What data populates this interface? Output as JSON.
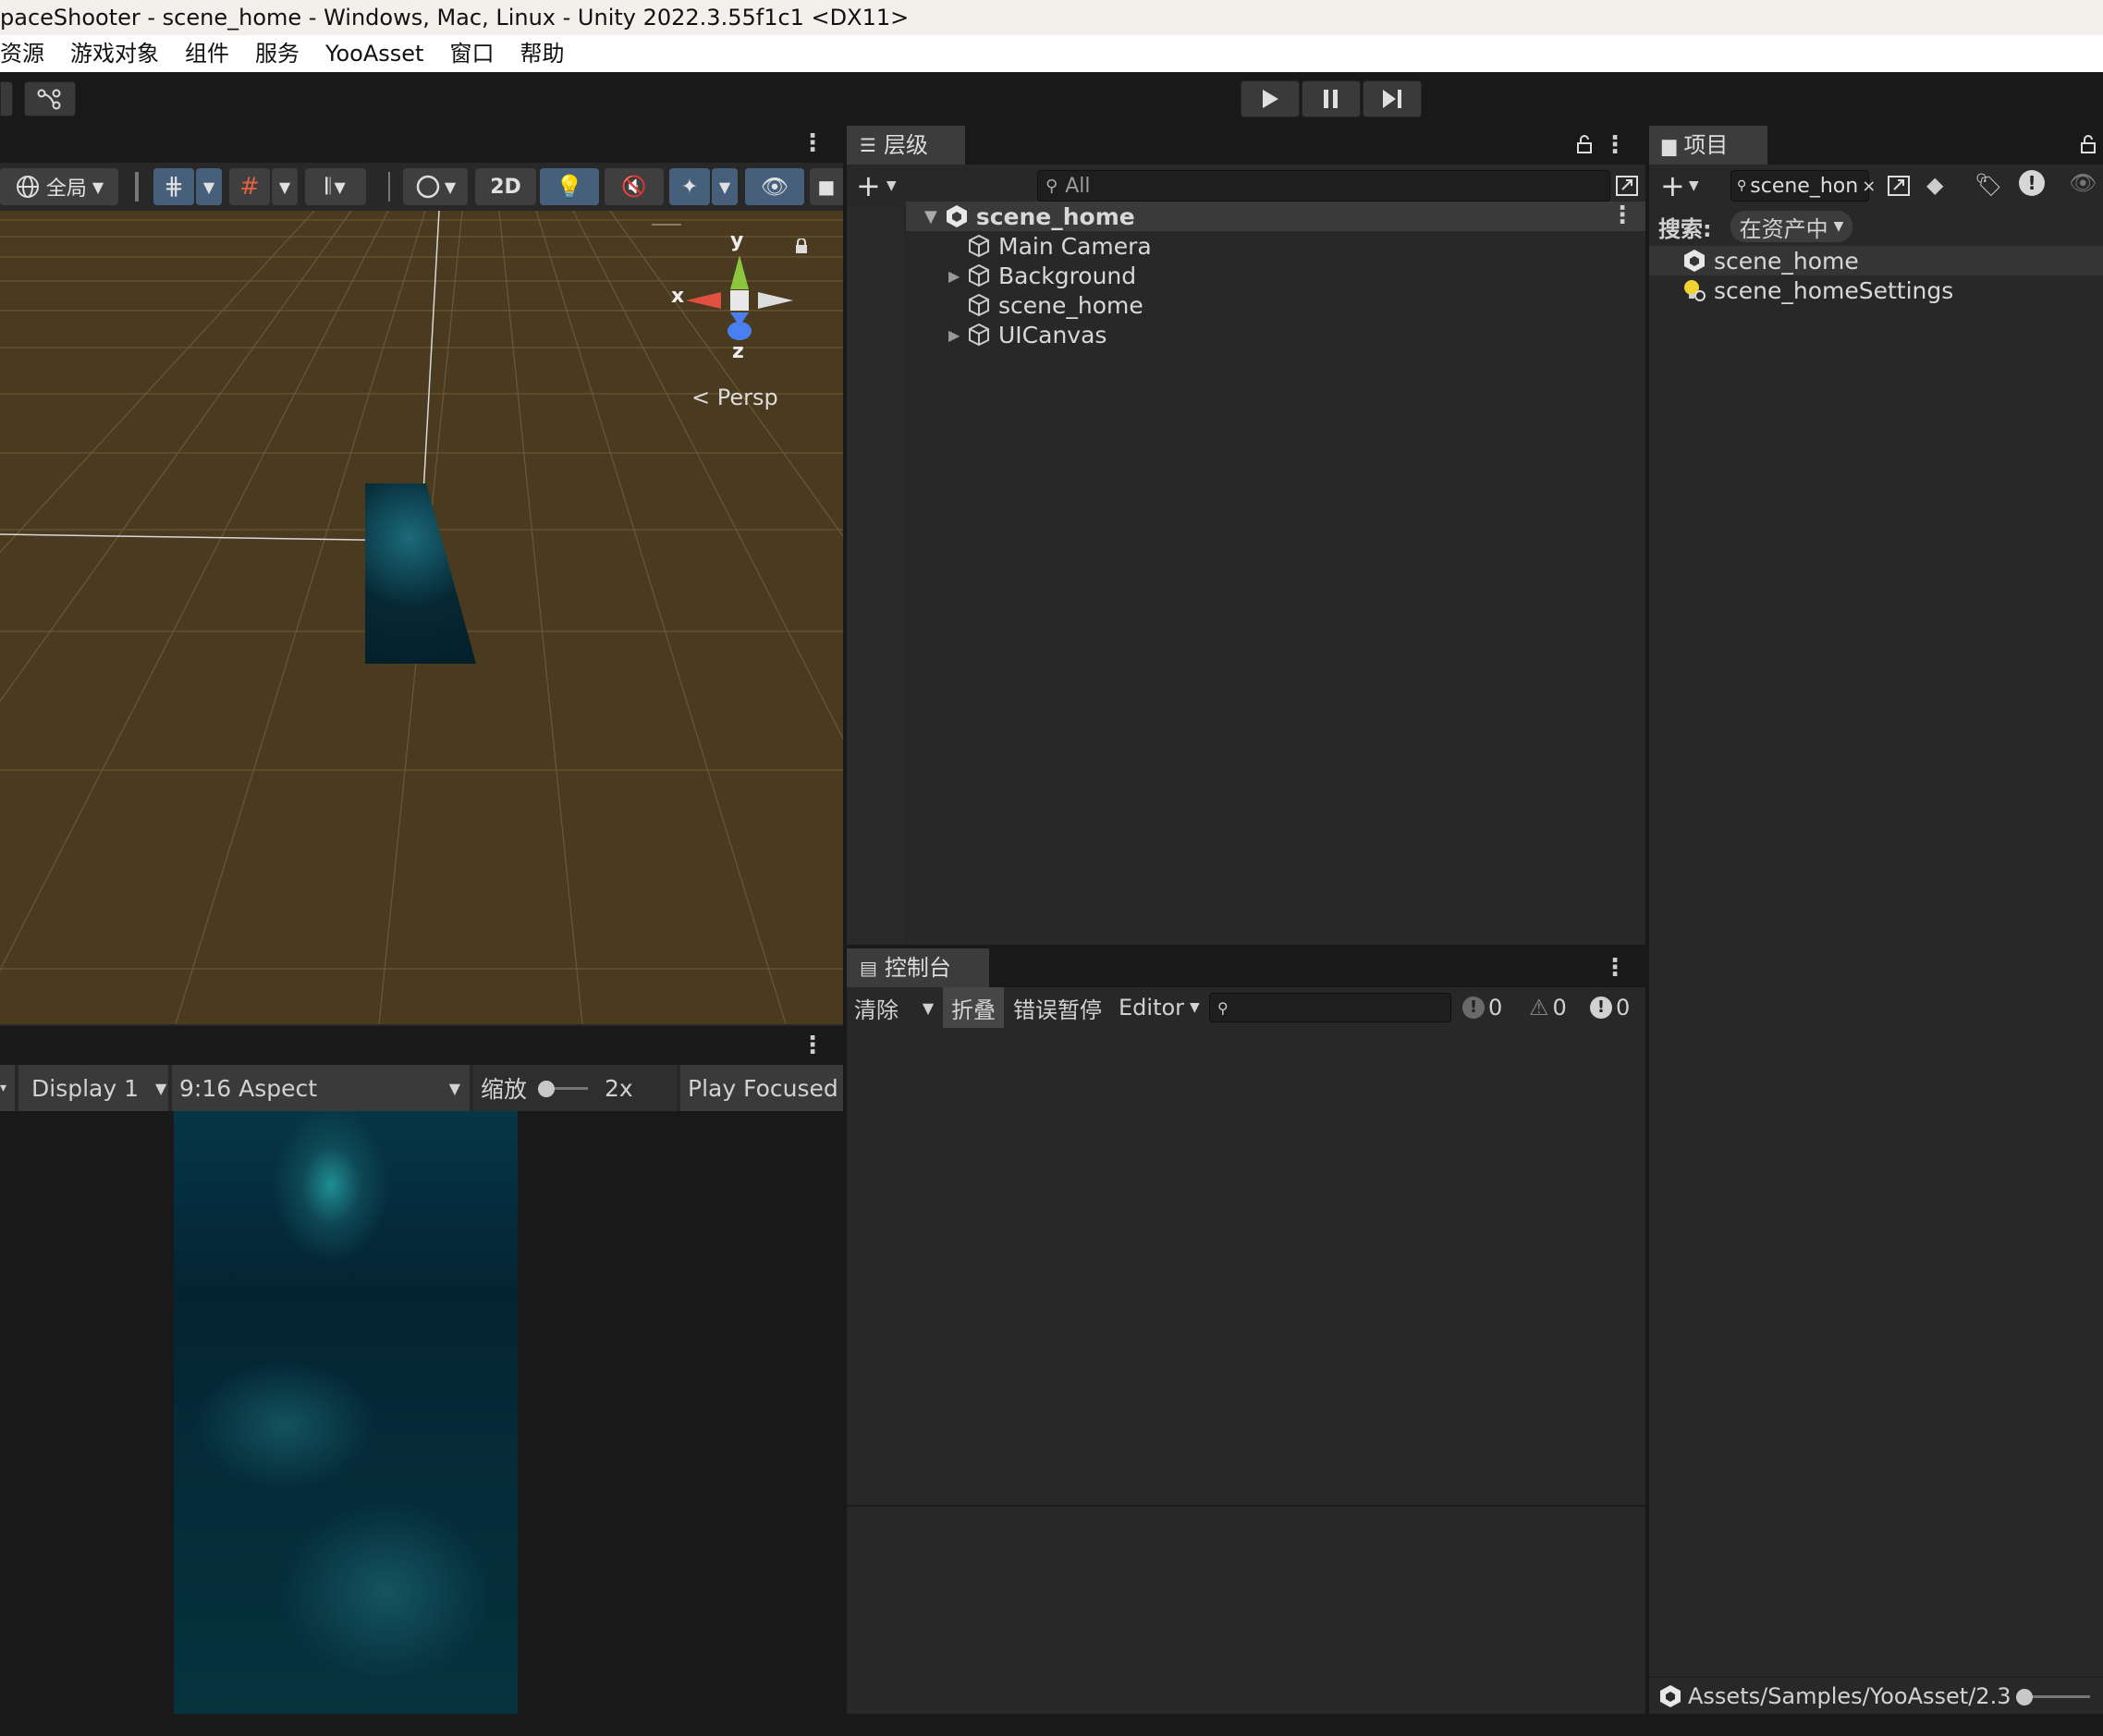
{
  "window": {
    "title": "paceShooter - scene_home - Windows, Mac, Linux - Unity 2022.3.55f1c1 <DX11>"
  },
  "menu": [
    "资源",
    "游戏对象",
    "组件",
    "服务",
    "YooAsset",
    "窗口",
    "帮助"
  ],
  "scene": {
    "toolbar": {
      "global_label": "全局",
      "two_d_label": "2D"
    },
    "gizmo": {
      "y": "y",
      "x": "x",
      "z": "z",
      "projection": "Persp"
    }
  },
  "game": {
    "display": "Display 1",
    "aspect": "9:16 Aspect",
    "scale_label": "缩放",
    "scale_value": "2x",
    "play_mode": "Play Focused"
  },
  "hierarchy": {
    "tab": "层级",
    "search_placeholder": "All",
    "root": "scene_home",
    "items": [
      {
        "label": "Main Camera",
        "expandable": false
      },
      {
        "label": "Background",
        "expandable": true
      },
      {
        "label": "scene_home",
        "expandable": false
      },
      {
        "label": "UICanvas",
        "expandable": true
      }
    ]
  },
  "console": {
    "tab": "控制台",
    "clear": "清除",
    "collapse": "折叠",
    "error_pause": "错误暂停",
    "editor": "Editor",
    "log_count": "0",
    "warn_count": "0",
    "error_count": "0"
  },
  "project": {
    "tab": "项目",
    "search_value": "scene_hon",
    "search_label": "搜索:",
    "search_scope": "在资产中",
    "items": [
      {
        "label": "scene_home",
        "icon": "unity-scene-icon"
      },
      {
        "label": "scene_homeSettings",
        "icon": "lighting-settings-icon"
      }
    ],
    "path": "Assets/Samples/YooAsset/2.3"
  }
}
